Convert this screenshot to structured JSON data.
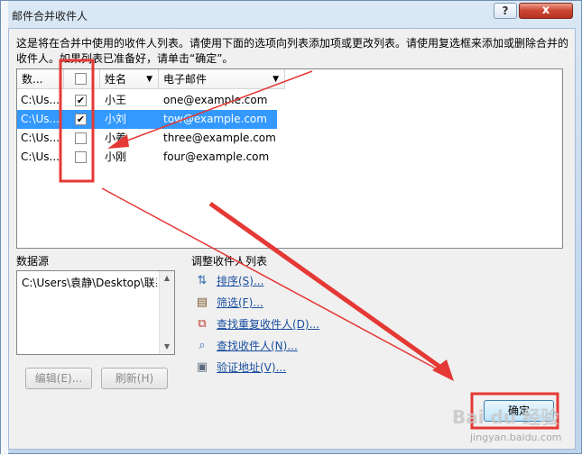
{
  "window": {
    "title": "邮件合并收件人",
    "help": "?",
    "close": "x"
  },
  "description": "这是将在合并中使用的收件人列表。请使用下面的选项向列表添加项或更改列表。请使用复选框来添加或删除合并的收件人。如果列表已准备好，请单击“确定”。",
  "list": {
    "columns": {
      "source": "数...",
      "name": "姓名",
      "email": "电子邮件"
    },
    "rows": [
      {
        "source": "C:\\Us...",
        "checked": "✔",
        "name": "小王",
        "email": "one@example.com"
      },
      {
        "source": "C:\\Us...",
        "checked": "✔",
        "name": "小刘",
        "email": "tow@example.com"
      },
      {
        "source": "C:\\Us...",
        "checked": "",
        "name": "小姜",
        "email": "three@example.com"
      },
      {
        "source": "C:\\Us...",
        "checked": "",
        "name": "小刚",
        "email": "four@example.com"
      }
    ]
  },
  "datasource": {
    "label": "数据源",
    "item": "C:\\Users\\袁静\\Desktop\\联系人.xlsx",
    "edit_button": "编辑(E)...",
    "refresh_button": "刷新(H)"
  },
  "refine": {
    "label": "调整收件人列表",
    "links": [
      {
        "text": "排序(S)...",
        "icon": "sort-icon"
      },
      {
        "text": "筛选(F)...",
        "icon": "filter-icon"
      },
      {
        "text": "查找重复收件人(D)...",
        "icon": "duplicates-icon"
      },
      {
        "text": "查找收件人(N)...",
        "icon": "find-icon"
      },
      {
        "text": "验证地址(V)...",
        "icon": "validate-icon"
      }
    ]
  },
  "ok_button": "确定",
  "watermark": {
    "text": "Bai du 经验",
    "url": "jingyan.baidu.com"
  },
  "colors": {
    "selection": "#3399ff",
    "annotation": "#e53935",
    "link": "#1a4fa0"
  }
}
